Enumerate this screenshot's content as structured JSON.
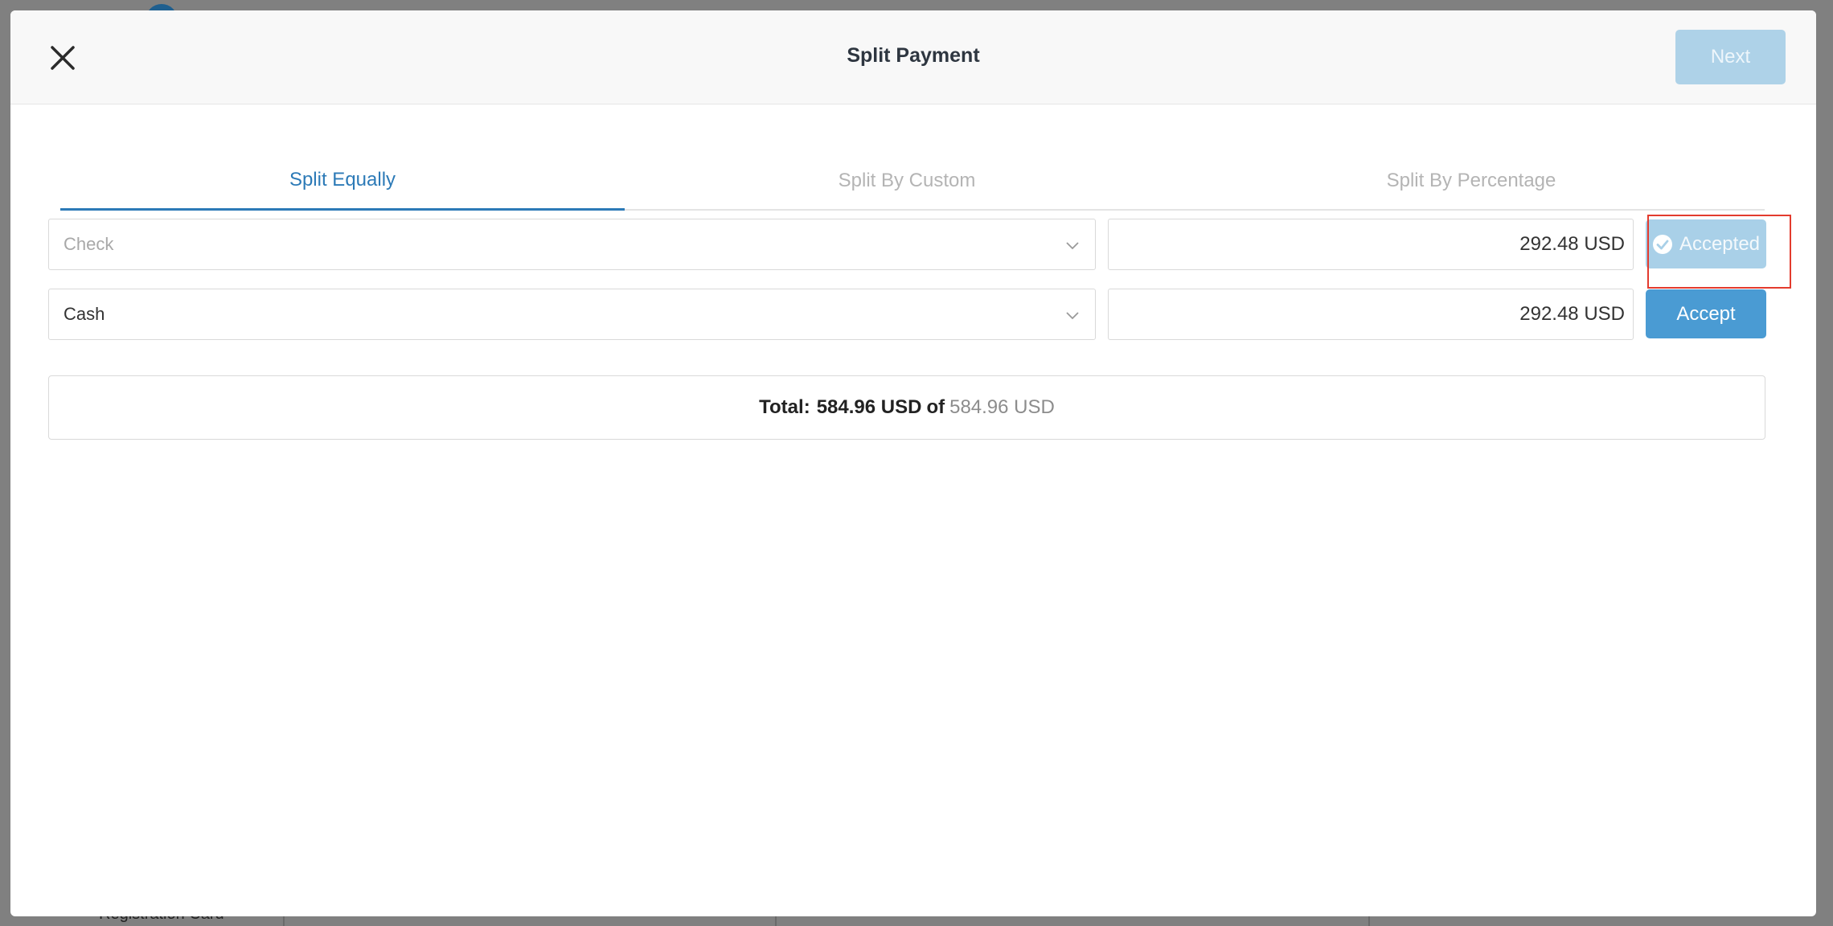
{
  "modal": {
    "title": "Split Payment",
    "next_label": "Next"
  },
  "tabs": [
    {
      "label": "Split Equally",
      "active": true
    },
    {
      "label": "Split By Custom",
      "active": false
    },
    {
      "label": "Split By Percentage",
      "active": false
    }
  ],
  "payments": [
    {
      "method": "Check",
      "method_color": "#a8a8a8",
      "amount": "292.48 USD",
      "action": "Accepted",
      "state": "accepted"
    },
    {
      "method": "Cash",
      "method_color": "#333333",
      "amount": "292.48 USD",
      "action": "Accept",
      "state": "pending"
    }
  ],
  "total": {
    "label": "Total:",
    "amount": "584.96 USD",
    "of": "of",
    "grand_total": "584.96 USD"
  },
  "background": {
    "footer_label": "Registration Card"
  },
  "colors": {
    "accent": "#2c7ab7",
    "accept_button": "#4a9bd3",
    "accepted_button": "#a9d0e8",
    "highlight": "#e33b2e"
  },
  "icons": {
    "close": "close-icon",
    "chevron": "chevron-down-icon",
    "accepted": "check-circle-icon"
  }
}
